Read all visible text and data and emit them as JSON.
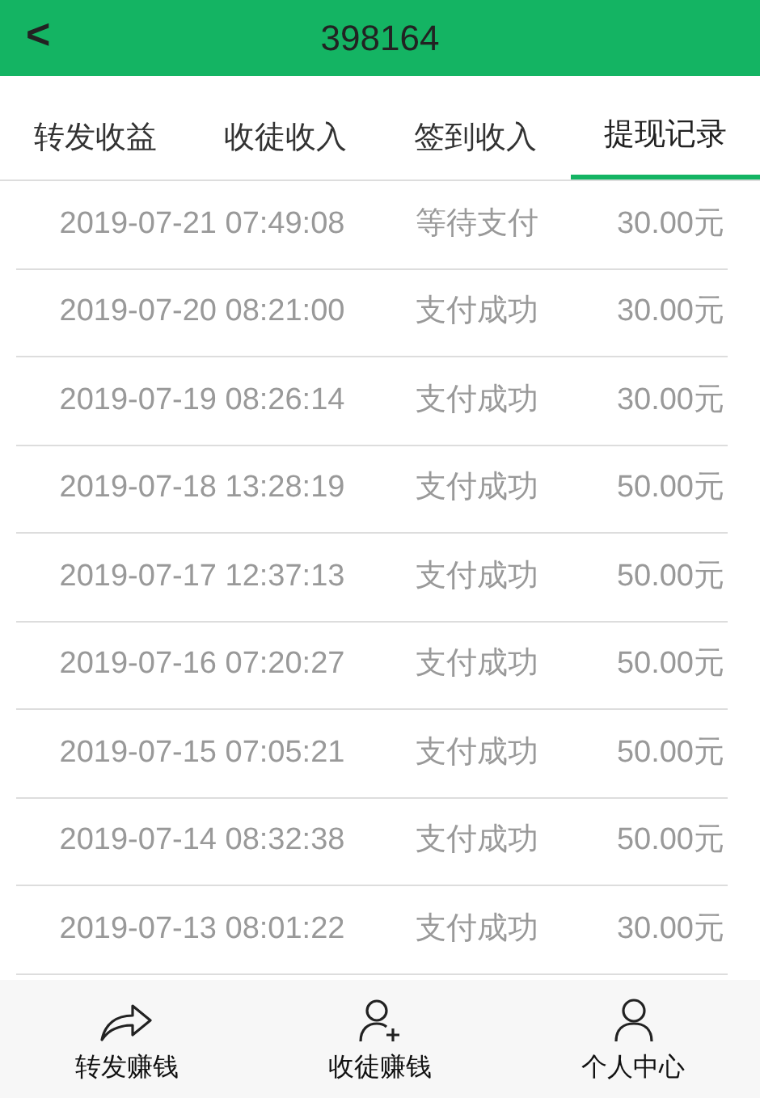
{
  "header": {
    "back": "<",
    "title": "398164"
  },
  "tabs": [
    {
      "label": "转发收益",
      "selected": false
    },
    {
      "label": "收徒收入",
      "selected": false
    },
    {
      "label": "签到收入",
      "selected": false
    },
    {
      "label": "提现记录",
      "selected": true
    }
  ],
  "records": [
    {
      "time": "2019-07-21 07:49:08",
      "status": "等待支付",
      "amount": "30.00元"
    },
    {
      "time": "2019-07-20 08:21:00",
      "status": "支付成功",
      "amount": "30.00元"
    },
    {
      "time": "2019-07-19 08:26:14",
      "status": "支付成功",
      "amount": "30.00元"
    },
    {
      "time": "2019-07-18 13:28:19",
      "status": "支付成功",
      "amount": "50.00元"
    },
    {
      "time": "2019-07-17 12:37:13",
      "status": "支付成功",
      "amount": "50.00元"
    },
    {
      "time": "2019-07-16 07:20:27",
      "status": "支付成功",
      "amount": "50.00元"
    },
    {
      "time": "2019-07-15 07:05:21",
      "status": "支付成功",
      "amount": "50.00元"
    },
    {
      "time": "2019-07-14 08:32:38",
      "status": "支付成功",
      "amount": "50.00元"
    },
    {
      "time": "2019-07-13 08:01:22",
      "status": "支付成功",
      "amount": "30.00元"
    }
  ],
  "bottom_nav": [
    {
      "kind": "share",
      "label": "转发赚钱"
    },
    {
      "kind": "add-user",
      "label": "收徒赚钱"
    },
    {
      "kind": "user",
      "label": "个人中心"
    }
  ]
}
